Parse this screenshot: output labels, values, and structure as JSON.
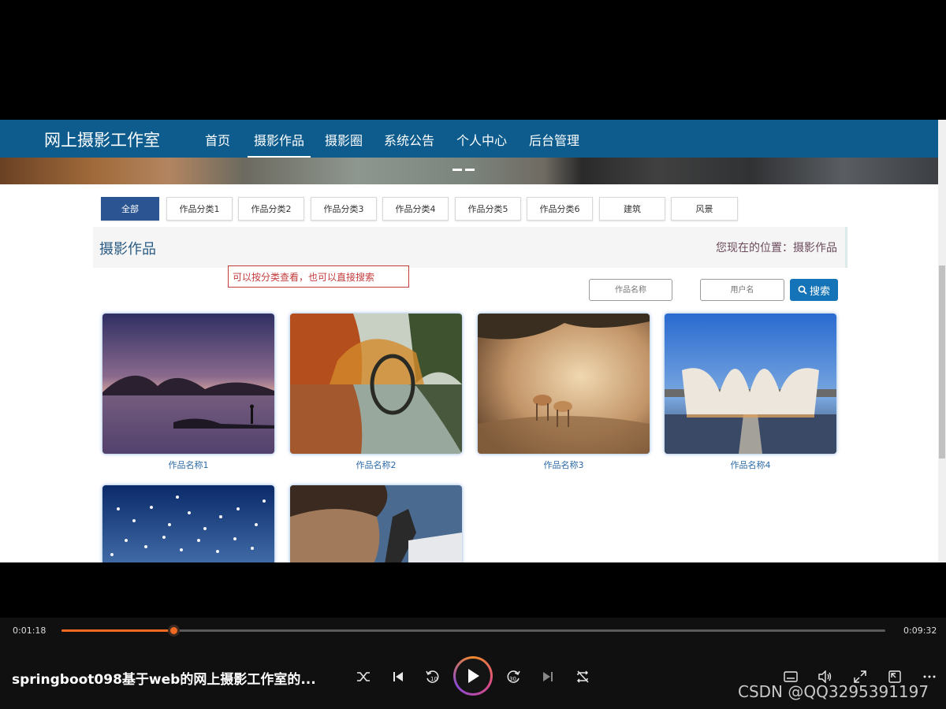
{
  "site": {
    "brand": "网上摄影工作室",
    "nav": [
      "首页",
      "摄影作品",
      "摄影圈",
      "系统公告",
      "个人中心",
      "后台管理"
    ],
    "active_nav": "摄影作品"
  },
  "categories": [
    "全部",
    "作品分类1",
    "作品分类2",
    "作品分类3",
    "作品分类4",
    "作品分类5",
    "作品分类6",
    "建筑",
    "风景"
  ],
  "active_category": "全部",
  "section": {
    "title": "摄影作品",
    "breadcrumb": "您现在的位置：摄影作品"
  },
  "annotation": "可以按分类查看，也可以直接搜索",
  "search": {
    "work_name_placeholder": "作品名称",
    "username_placeholder": "用户名",
    "button_label": "搜索"
  },
  "works": [
    {
      "name": "作品名称1"
    },
    {
      "name": "作品名称2"
    },
    {
      "name": "作品名称3"
    },
    {
      "name": "作品名称4"
    },
    {
      "name": ""
    },
    {
      "name": ""
    }
  ],
  "player": {
    "elapsed": "0:01:18",
    "duration": "0:09:32",
    "progress": 0.1364,
    "title": "springboot098基于web的网上摄影工作室的...",
    "watermark": "CSDN @QQ3295391197",
    "accent_color": "#f26a21"
  }
}
